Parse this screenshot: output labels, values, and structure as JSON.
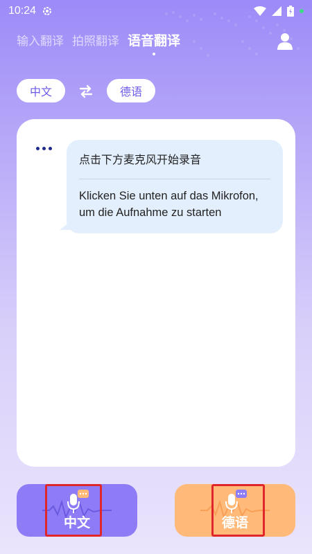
{
  "status_bar": {
    "time": "10:24",
    "icons": [
      "settings-gear-icon",
      "wifi-icon",
      "signal-icon",
      "battery-charging-icon",
      "notification-dot"
    ]
  },
  "tabs": [
    {
      "label": "输入翻译",
      "active": false
    },
    {
      "label": "拍照翻译",
      "active": false
    },
    {
      "label": "语音翻译",
      "active": true
    }
  ],
  "header": {
    "profile_icon": "user-profile-icon"
  },
  "language_selector": {
    "source": "中文",
    "target": "德语",
    "swap_icon": "swap-arrows-icon"
  },
  "conversation": {
    "prompt_zh": "点击下方麦克风开始录音",
    "prompt_de_line1": "Klicken Sie unten auf das Mikrofon,",
    "prompt_de_line2": "um die Aufnahme zu starten"
  },
  "buttons": {
    "mic_source_label": "中文",
    "mic_target_label": "德语"
  },
  "colors": {
    "accent_purple": "#8E7CF6",
    "accent_orange": "#FFB978",
    "bubble_bg": "#E3EFFD",
    "highlight_red": "#E0262B"
  }
}
